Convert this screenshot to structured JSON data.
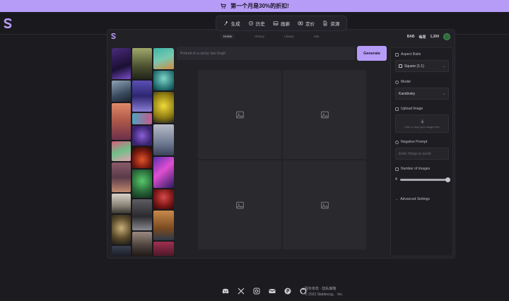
{
  "promo": {
    "text": "第一个月是30%的折扣!",
    "bg": "#b69cf7"
  },
  "nav": {
    "items": [
      {
        "label": "生成",
        "icon": "wand-icon"
      },
      {
        "label": "历史",
        "icon": "clock-icon"
      },
      {
        "label": "画廊",
        "icon": "image-icon"
      },
      {
        "label": "定价",
        "icon": "money-icon"
      },
      {
        "label": "资源",
        "icon": "document-icon"
      }
    ]
  },
  "subheader": {
    "tabs": [
      {
        "label": "Home",
        "active": true
      },
      {
        "label": "History",
        "active": false
      },
      {
        "label": "Library",
        "active": false
      },
      {
        "label": "Site",
        "active": false
      }
    ],
    "credits_label_a": "BAB",
    "credits_label_b": "每周",
    "credits_value": "1,309"
  },
  "prompt": {
    "placeholder": "Portrait of a cat by Van Gogh"
  },
  "generate_label": "Generate",
  "settings": {
    "aspect_ratio_label": "Aspect Ratio",
    "aspect_ratio_value": "Square (1:1)",
    "model_label": "Model",
    "model_value": "Kandinsky",
    "upload_label": "Upload Image",
    "upload_hint": "Click or drop your image here",
    "negative_label": "Negative Prompt",
    "negative_placeholder": "Enter things to avoid",
    "num_images_label": "Number of Images",
    "num_images_value": "4",
    "num_images_fraction": 1.0,
    "advanced_label": "Advanced Settings"
  },
  "footer": {
    "links": "服务条款 · 隐私策略",
    "copyright": "© 2023 Stablecog。 Inc.",
    "icons": [
      "discord-icon",
      "x-icon",
      "instagram-icon",
      "mail-icon",
      "producthunt-icon",
      "github-icon"
    ]
  },
  "colors": {
    "accent": "#b69cf7",
    "bg": "#1c1b1f",
    "panel": "#222126"
  }
}
